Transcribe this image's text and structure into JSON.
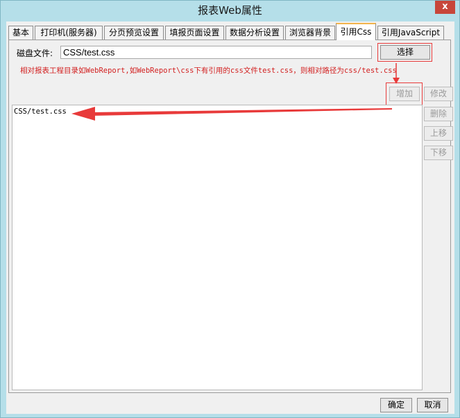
{
  "window": {
    "title": "报表Web属性",
    "close_label": "x"
  },
  "tabs": [
    {
      "label": "基本"
    },
    {
      "label": "打印机(服务器)"
    },
    {
      "label": "分页预览设置"
    },
    {
      "label": "填报页面设置"
    },
    {
      "label": "数据分析设置"
    },
    {
      "label": "浏览器背景"
    },
    {
      "label": "引用Css",
      "active": true
    },
    {
      "label": "引用JavaScript"
    }
  ],
  "css_panel": {
    "disk_file_label": "磁盘文件:",
    "disk_file_value": "CSS/test.css",
    "choose_label": "选择",
    "hint": "相对报表工程目录如WebReport,如WebReport\\css下有引用的css文件test.css，则相对路径为css/test.css",
    "buttons": {
      "add": "增加",
      "modify": "修改",
      "delete": "删除",
      "move_up": "上移",
      "move_down": "下移"
    },
    "list_items": [
      "CSS/test.css"
    ]
  },
  "footer": {
    "ok": "确定",
    "cancel": "取消"
  },
  "colors": {
    "annotation_red": "#e83a3a",
    "hint_red": "#d21f1f",
    "active_tab_accent": "#f2b44b"
  }
}
